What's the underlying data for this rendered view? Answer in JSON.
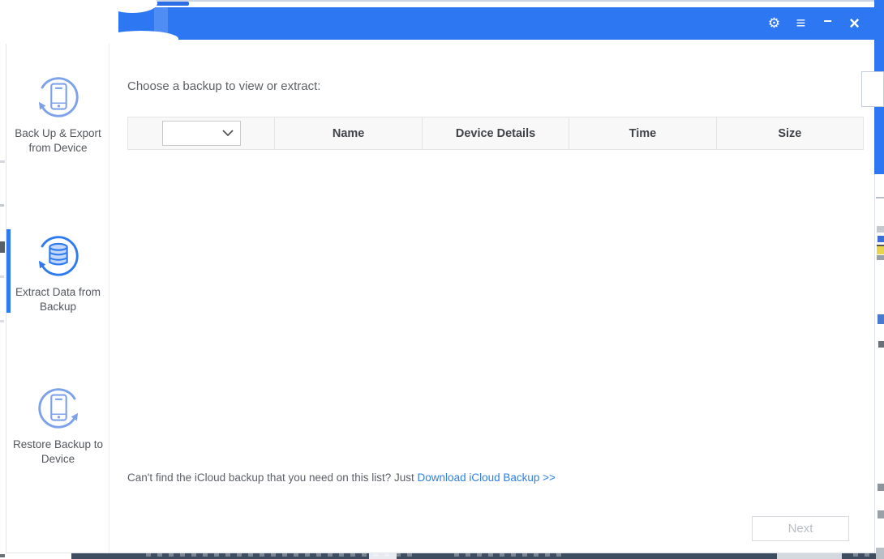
{
  "titlebar": {
    "icons": {
      "gear": "⚙",
      "menu": "≡",
      "minimize": "−",
      "close": "×"
    }
  },
  "sidebar": {
    "items": [
      {
        "label": "Back Up & Export from Device"
      },
      {
        "label": "Extract Data from Backup"
      },
      {
        "label": "Restore Backup to Device"
      }
    ],
    "active_index": 1
  },
  "main": {
    "heading": "Choose a backup to view or extract:",
    "table": {
      "filter_value": "",
      "columns": [
        "Name",
        "Device Details",
        "Time",
        "Size"
      ]
    },
    "footer": {
      "text": "Can't find the iCloud backup that you need on this list? Just ",
      "link": "Download iCloud Backup >>"
    },
    "next_label": "Next"
  },
  "colors": {
    "titlebar_blue": "#2e77f2",
    "accent_blue": "#2e7bf0",
    "inactive_icon_blue": "#7da2ea",
    "link_blue": "#2d7fe8",
    "table_header_bg": "#f8f8f8",
    "bottom_bar": "#3e4e60"
  }
}
